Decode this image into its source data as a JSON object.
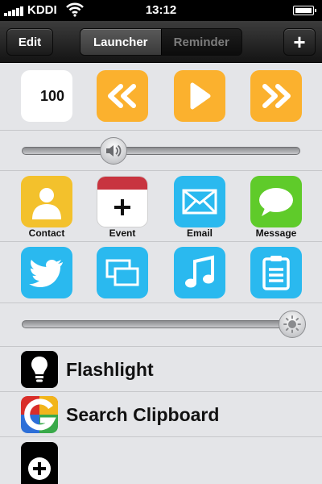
{
  "status_bar": {
    "carrier": "KDDI",
    "time": "13:12"
  },
  "nav": {
    "edit_label": "Edit",
    "segments": [
      "Launcher",
      "Reminder"
    ],
    "add_label": "+"
  },
  "launcher": {
    "media_logo_text": "100",
    "app_captions": [
      "Contact",
      "Event",
      "Email",
      "Message"
    ],
    "volume_level": 0.33,
    "brightness_level": 0.97,
    "list": [
      {
        "label": "Flashlight",
        "icon": "lightbulb-icon"
      },
      {
        "label": "Search Clipboard",
        "icon": "google-icon"
      },
      {
        "label": "",
        "icon": "add-icon"
      }
    ]
  },
  "colors": {
    "orange": "#fbb12e",
    "blue": "#2ab9ef",
    "green": "#5fcb2a",
    "yellow": "#f3c12c"
  }
}
